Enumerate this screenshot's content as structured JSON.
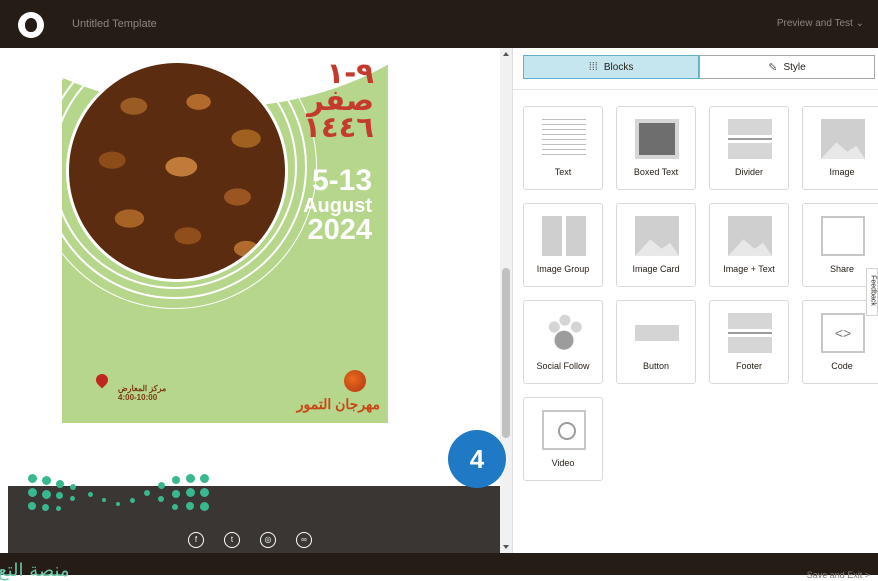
{
  "header": {
    "app_title": "Untitled Template",
    "preview_label": "Preview and Test",
    "preview_chevron": "⌄"
  },
  "poster": {
    "hijri_line1": "٩-١",
    "hijri_line2": "صفر",
    "hijri_line3": "١٤٤٦",
    "greg_days": "5-13",
    "greg_month": "August",
    "greg_year": "2024",
    "venue_name": "مركز المعارض",
    "venue_time": "4:00-10:00",
    "festival_name": "مهرجان التمور"
  },
  "footer": {
    "social_icons": [
      "facebook-icon",
      "twitter-icon",
      "instagram-icon",
      "link-icon"
    ]
  },
  "step_badge": "4",
  "tabs": {
    "blocks_label": "Blocks",
    "style_label": "Style"
  },
  "blocks": [
    {
      "label": "Text"
    },
    {
      "label": "Boxed Text"
    },
    {
      "label": "Divider"
    },
    {
      "label": "Image"
    },
    {
      "label": "Image Group"
    },
    {
      "label": "Image Card"
    },
    {
      "label": "Image + Text"
    },
    {
      "label": "Share"
    },
    {
      "label": "Social Follow"
    },
    {
      "label": "Button"
    },
    {
      "label": "Footer"
    },
    {
      "label": "Code"
    },
    {
      "label": "Video"
    }
  ],
  "feedback_label": "Feedback",
  "save_exit_label": "Save and Exit >",
  "watermark_text": "منصة التع",
  "colors": {
    "topbar": "#241c15",
    "active_tab": "#c6e6ef",
    "poster_bg": "#b6d68c",
    "hijri": "#c43b2e",
    "badge": "#1f79c5"
  }
}
